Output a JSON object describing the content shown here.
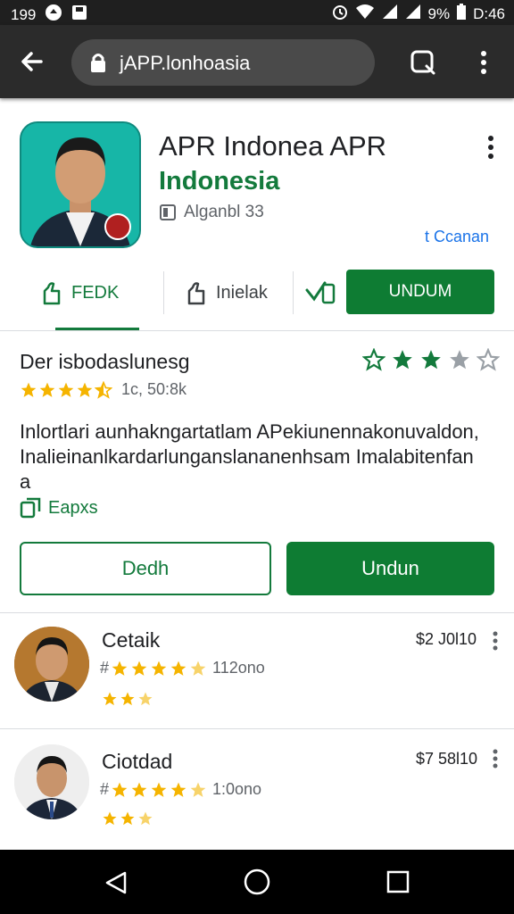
{
  "status_bar": {
    "time_left": "199",
    "battery": "9%",
    "clock": "D:46"
  },
  "browser": {
    "url": "jAPP.lonhoasia"
  },
  "app": {
    "title": "APR Indonea APR",
    "developer": "Indonesia",
    "meta": "Alganbl 33",
    "side_link": "t Ccanan"
  },
  "actions": {
    "feed_label": "FEDK",
    "install_label": "Inielak",
    "undum_label": "UNDUM"
  },
  "details": {
    "title": "Der isbodaslunesg",
    "rating_count": "1c, 50:8k",
    "description_lines": [
      "Inlortlari aunhakngartatlam APekiunennakonuvaldon,",
      "Inalieinanlkardarlunganslananenhsam Imalabitenfan",
      "a"
    ],
    "feature_label": "Eapxs",
    "outline_button": "Dedh",
    "fill_button": "Undun"
  },
  "reviews": [
    {
      "name": "Cetaik",
      "price": "$2 J0l10",
      "count": "112ono",
      "stars": 4.5
    },
    {
      "name": "Ciotdad",
      "price": "$7 58l10",
      "count": "1:0ono",
      "stars": 4.5
    }
  ],
  "colors": {
    "accent": "#137a3c",
    "button": "#0e7c33",
    "link": "#1a73e8",
    "star": "#f5b400",
    "icon_bg": "#17b6a7"
  },
  "icons": [
    "back-arrow-icon",
    "lock-icon",
    "tabs-icon",
    "more-vert-icon",
    "feed-icon",
    "install-icon",
    "device-check-icon",
    "star-icon",
    "feature-icon"
  ]
}
